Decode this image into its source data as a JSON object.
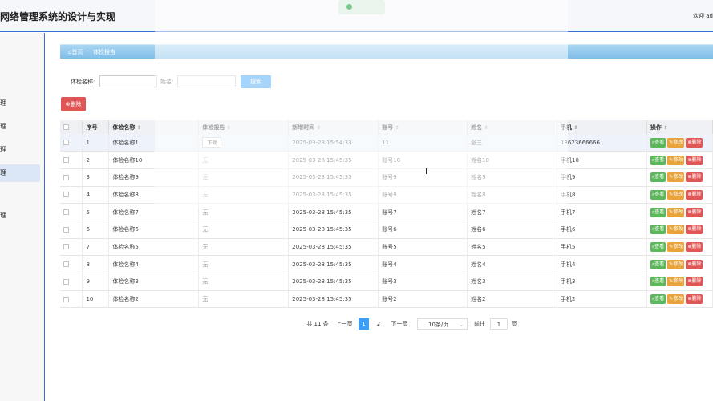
{
  "header": {
    "title": "网络管理系统的设计与实现",
    "welcome": "欢迎 ad"
  },
  "sidebar": {
    "items": [
      {
        "label": "理"
      },
      {
        "label": "理"
      },
      {
        "label": "理"
      },
      {
        "label": "理"
      },
      {
        "label": "理"
      }
    ]
  },
  "breadcrumb": {
    "home": "首页",
    "sep": "-",
    "current": "体检报告"
  },
  "filters": {
    "name_label": "体检名称:",
    "name_value": "",
    "person_label": "姓名:",
    "person_value": "",
    "search_label": "搜索"
  },
  "toolbar": {
    "delete_label": "删除"
  },
  "table": {
    "columns": [
      "序号",
      "体检名称",
      "体检报告",
      "新增时间",
      "账号",
      "姓名",
      "手机",
      "操作"
    ],
    "actions": {
      "view": "查看",
      "edit": "修改",
      "delete": "删除"
    },
    "rows": [
      {
        "idx": "1",
        "name": "体检名称1",
        "report": "下载",
        "time": "2025-03-28 15:54:33",
        "account": "11",
        "person": "张三",
        "phone": "13623666666"
      },
      {
        "idx": "2",
        "name": "体检名称10",
        "report": "无",
        "time": "2025-03-28 15:45:35",
        "account": "账号10",
        "person": "姓名10",
        "phone": "手机10"
      },
      {
        "idx": "3",
        "name": "体检名称9",
        "report": "无",
        "time": "2025-03-28 15:45:35",
        "account": "账号9",
        "person": "姓名9",
        "phone": "手机9"
      },
      {
        "idx": "4",
        "name": "体检名称8",
        "report": "无",
        "time": "2025-03-28 15:45:35",
        "account": "账号8",
        "person": "姓名8",
        "phone": "手机8"
      },
      {
        "idx": "5",
        "name": "体检名称7",
        "report": "无",
        "time": "2025-03-28 15:45:35",
        "account": "账号7",
        "person": "姓名7",
        "phone": "手机7"
      },
      {
        "idx": "6",
        "name": "体检名称6",
        "report": "无",
        "time": "2025-03-28 15:45:35",
        "account": "账号6",
        "person": "姓名6",
        "phone": "手机6"
      },
      {
        "idx": "7",
        "name": "体检名称5",
        "report": "无",
        "time": "2025-03-28 15:45:35",
        "account": "账号5",
        "person": "姓名5",
        "phone": "手机5"
      },
      {
        "idx": "8",
        "name": "体检名称4",
        "report": "无",
        "time": "2025-03-28 15:45:35",
        "account": "账号4",
        "person": "姓名4",
        "phone": "手机4"
      },
      {
        "idx": "9",
        "name": "体检名称3",
        "report": "无",
        "time": "2025-03-28 15:45:35",
        "account": "账号3",
        "person": "姓名3",
        "phone": "手机3"
      },
      {
        "idx": "10",
        "name": "体检名称2",
        "report": "无",
        "time": "2025-03-28 15:45:35",
        "account": "账号2",
        "person": "姓名2",
        "phone": "手机2"
      }
    ]
  },
  "pagination": {
    "total": "共 11 条",
    "prev": "上一页",
    "pages": [
      "1",
      "2"
    ],
    "current": "1",
    "next": "下一页",
    "page_size": "10条/页",
    "goto_label": "前往",
    "goto_value": "1",
    "goto_suffix": "页"
  },
  "colors": {
    "primary": "#3c9ff5",
    "danger": "#e05656",
    "success": "#5db85c",
    "warning": "#e8a33d",
    "header_accent": "#3a6fd0"
  }
}
